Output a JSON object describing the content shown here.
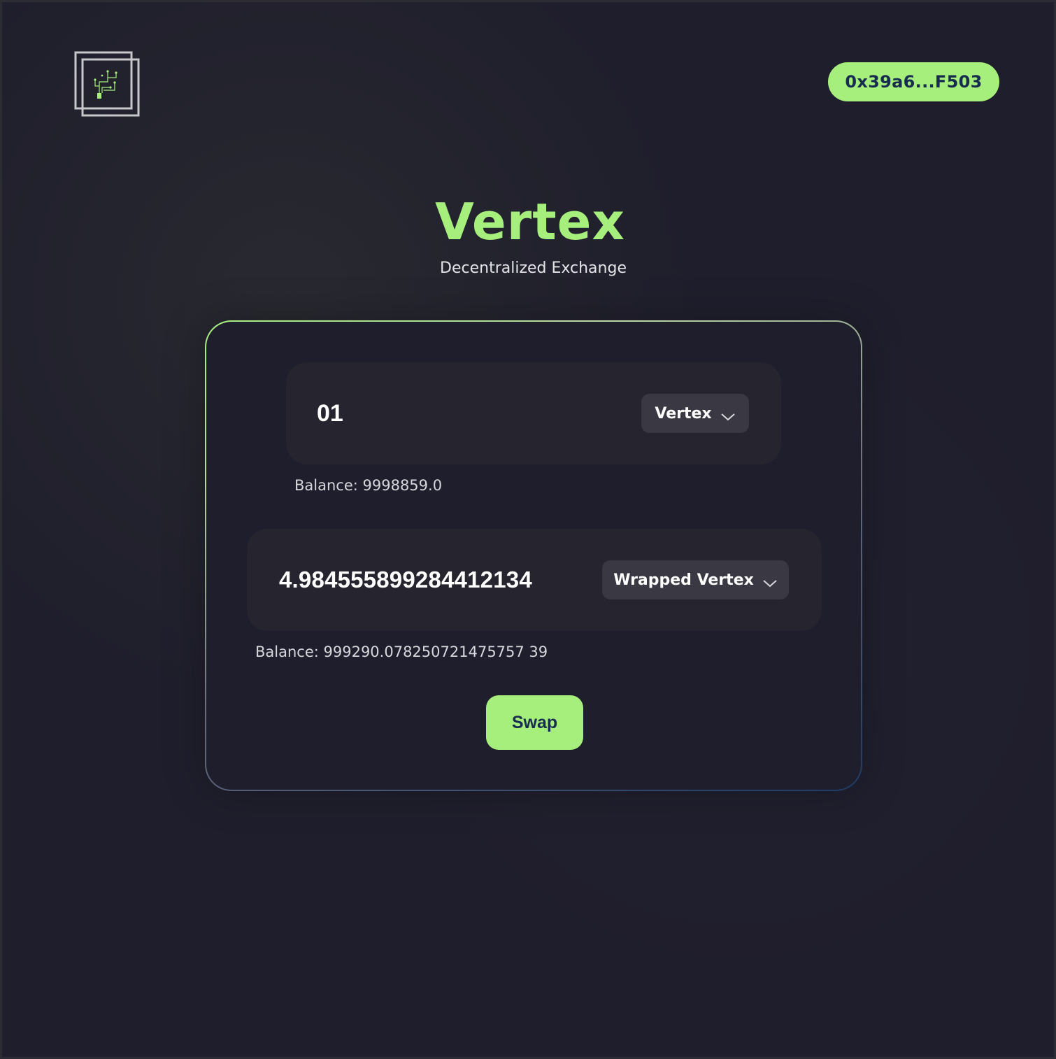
{
  "header": {
    "logo_icon": "circuit-logo-icon",
    "wallet_address": "0x39a6...F503"
  },
  "hero": {
    "title": "Vertex",
    "subtitle": "Decentralized Exchange"
  },
  "swap": {
    "from": {
      "amount": "01",
      "token": "Vertex",
      "balance": "Balance: 9998859.0"
    },
    "to": {
      "amount": "4.984555899284412134",
      "token": "Wrapped Vertex",
      "balance": "Balance: 999290.078250721475757 39"
    },
    "button_label": "Swap"
  },
  "colors": {
    "accent": "#a6ef7d",
    "accent_text": "#172c4e",
    "background": "#1f1e2c",
    "field": "#26252f",
    "token_button": "#393843"
  }
}
